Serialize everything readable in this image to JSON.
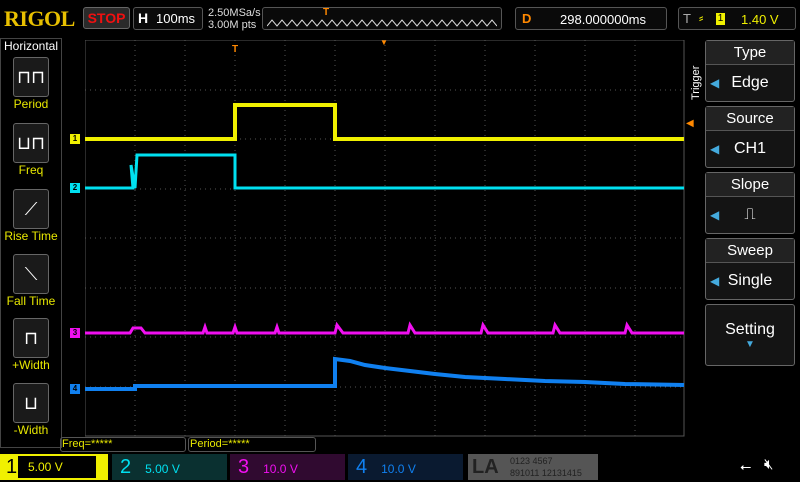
{
  "header": {
    "logo": "RIGOL",
    "run_state": "STOP",
    "h_label": "H",
    "timebase": "100ms",
    "sample_rate": "2.50MSa/s",
    "mem_depth": "3.00M pts",
    "delay_label": "D",
    "delay": "298.000000ms",
    "trig_label": "T",
    "trig_source": "1",
    "trig_level": "1.40 V"
  },
  "sidebar": {
    "title": "Horizontal",
    "items": [
      {
        "label": "Period",
        "icon": "period-icon"
      },
      {
        "label": "Freq",
        "icon": "freq-icon"
      },
      {
        "label": "Rise Time",
        "icon": "rise-time-icon"
      },
      {
        "label": "Fall Time",
        "icon": "fall-time-icon"
      },
      {
        "label": "+Width",
        "icon": "pos-width-icon"
      },
      {
        "label": "-Width",
        "icon": "neg-width-icon"
      }
    ]
  },
  "menu": {
    "title": "Trigger",
    "items": [
      {
        "title": "Type",
        "value": "Edge"
      },
      {
        "title": "Source",
        "value": "CH1"
      },
      {
        "title": "Slope",
        "value": "rising"
      },
      {
        "title": "Sweep",
        "value": "Single"
      }
    ],
    "setting": "Setting"
  },
  "measurements": {
    "freq": "Freq=*****",
    "period": "Period=*****"
  },
  "channels": [
    {
      "num": "1",
      "scale": "5.00 V",
      "color": "#f0f000"
    },
    {
      "num": "2",
      "scale": "5.00 V",
      "color": "#00e0f0"
    },
    {
      "num": "3",
      "scale": "10.0 V",
      "color": "#f010f0"
    },
    {
      "num": "4",
      "scale": "10.0 V",
      "color": "#1080f0"
    }
  ],
  "la": {
    "label": "LA",
    "row1": "0123 4567",
    "row2": "891011 12131415"
  }
}
